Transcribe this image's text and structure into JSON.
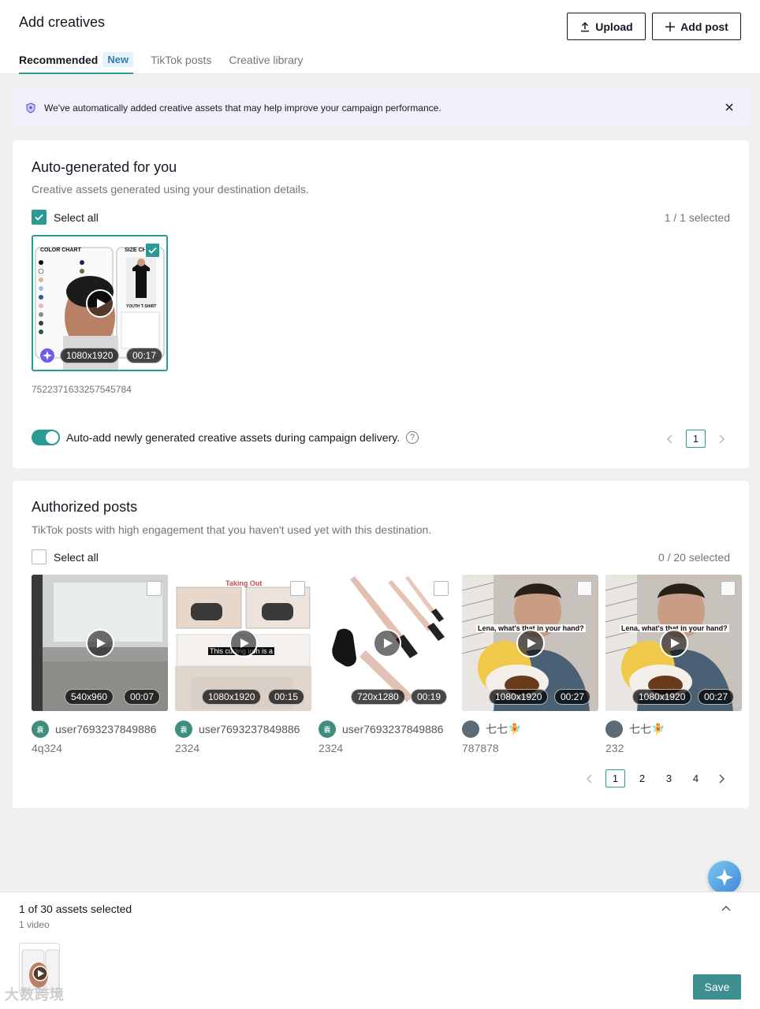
{
  "header": {
    "title": "Add creatives",
    "upload_label": "Upload",
    "add_post_label": "Add post",
    "tabs": [
      {
        "label": "Recommended",
        "badge": "New"
      },
      {
        "label": "TikTok posts"
      },
      {
        "label": "Creative library"
      }
    ]
  },
  "banner": {
    "text": "We've automatically added creative assets that may help improve your campaign performance."
  },
  "auto_generated": {
    "title": "Auto-generated for you",
    "subtitle": "Creative assets generated using your destination details.",
    "select_all_label": "Select all",
    "selected_count": "1 / 1 selected",
    "asset": {
      "resolution": "1080x1920",
      "duration": "00:17",
      "id": "7522371633257545784",
      "selected": true,
      "thumb_text": {
        "left": "COLOR CHART",
        "right": "SIZE CH",
        "right_bottom": "YOUTH T-SHIRT"
      }
    },
    "auto_add_label": "Auto-add newly generated creative assets during campaign delivery.",
    "help_glyph": "?",
    "page": "1"
  },
  "authorized_posts": {
    "title": "Authorized posts",
    "subtitle": "TikTok posts with high engagement that you haven't used yet with this destination.",
    "select_all_label": "Select all",
    "selected_count": "0 / 20 selected",
    "posts": [
      {
        "resolution": "540x960",
        "duration": "00:07",
        "author": "user7693237849886",
        "avatar_text": "囊",
        "caption": "4q324"
      },
      {
        "resolution": "1080x1920",
        "duration": "00:15",
        "author": "user7693237849886",
        "avatar_text": "囊",
        "caption": "2324",
        "overlay_top": "Taking Out",
        "overlay_mid": "This curling iron is a"
      },
      {
        "resolution": "720x1280",
        "duration": "00:19",
        "author": "user7693237849886",
        "avatar_text": "囊",
        "caption": "2324"
      },
      {
        "resolution": "1080x1920",
        "duration": "00:27",
        "author": "七七🧚",
        "caption": "787878",
        "overlay_top": "Lena, what's that in your hand?"
      },
      {
        "resolution": "1080x1920",
        "duration": "00:27",
        "author": "七七🧚",
        "caption": "232",
        "overlay_top": "Lena, what's that in your hand?"
      }
    ],
    "pages": [
      "1",
      "2",
      "3",
      "4"
    ],
    "current_page": "1"
  },
  "footer": {
    "summary": "1 of 30 assets selected",
    "detail": "1 video",
    "save_label": "Save",
    "brand_watermark": "大数跨境"
  },
  "colors": {
    "accent": "#2a9a94",
    "save_button": "#3d8f8f",
    "banner_bg": "#eff0fa",
    "badge_text": "#2f7eb6"
  },
  "icons": [
    "upload-icon",
    "plus-icon",
    "shield-info-icon",
    "close-icon",
    "checkmark-icon",
    "play-icon",
    "sparkle-icon",
    "chevron-left-icon",
    "chevron-right-icon",
    "chevron-up-icon",
    "help-icon",
    "ai-assistant-icon"
  ]
}
